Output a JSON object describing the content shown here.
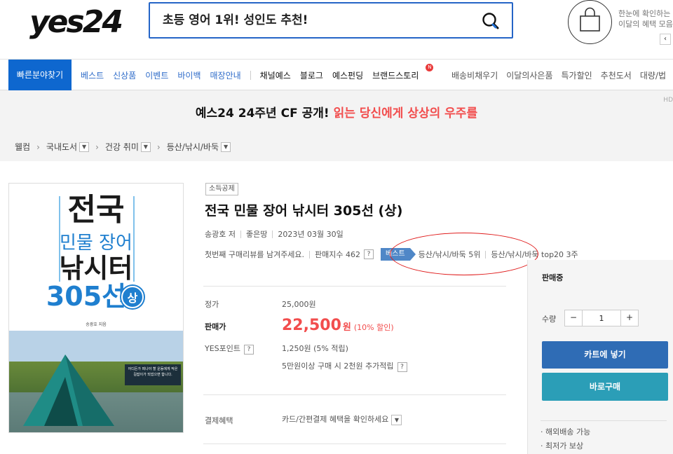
{
  "header": {
    "logo_text": "yes24",
    "search_placeholder": "초등 영어 1위! 성인도 추천!",
    "benefit_line1": "한눈에 확인하는",
    "benefit_line2": "이달의 혜택 모음",
    "scroll_right": "‹"
  },
  "gnb": {
    "quick": "빠른분야찾기",
    "blue_items": [
      "베스트",
      "신상품",
      "이벤트",
      "바이백",
      "매장안내"
    ],
    "dark_items": [
      "채널예스",
      "블로그",
      "예스펀딩",
      "브랜드스토리"
    ],
    "new_badge": "N",
    "right_items": [
      "배송비채우기",
      "이달의사은품",
      "특가할인",
      "추천도서",
      "대량/법"
    ]
  },
  "banner": {
    "text": "예스24 24주년 CF 공개!",
    "highlight": "읽는 당신에게 상상의 우주를",
    "corner": "HD"
  },
  "breadcrumb": [
    "웰컴",
    "국내도서",
    "건강 취미",
    "등산/낚시/바둑"
  ],
  "cover": {
    "line1": "전국",
    "line2": "민물 장어",
    "line3": "낚시터",
    "line4": "305선",
    "badge": "상",
    "author": "송광호 지음",
    "ribbon": "어디든가 떠나야 할 운동에게 작은 길잡이가 되었으면 합니다."
  },
  "product": {
    "tag": "소득공제",
    "title": "전국 민물 장어 낚시터 305선 (상)",
    "author": "송광호 저",
    "publisher": "좋은땅",
    "date": "2023년 03월 30일",
    "review_prompt": "첫번째 구매리뷰를 남겨주세요.",
    "sales_index": "판매지수 462",
    "help": "?",
    "best_label": "베스트",
    "best_rank": "등산/낚시/바둑 5위",
    "best_top": "등산/낚시/바둑 top20 3주"
  },
  "pricing": {
    "list_label": "정가",
    "list_price": "25,000원",
    "sale_label": "판매가",
    "sale_price": "22,500",
    "sale_unit": "원",
    "discount": "(10% 할인)",
    "point_label": "YES포인트",
    "point_value": "1,250원 (5% 적립)",
    "extra_point": "5만원이상 구매 시 2천원 추가적립",
    "payment_label": "결제혜택",
    "payment_value": "카드/간편결제 혜택을 확인하세요"
  },
  "sidebox": {
    "status": "판매중",
    "qty_label": "수량",
    "qty_value": "1",
    "minus": "−",
    "plus": "+",
    "cart": "카트에 넣기",
    "buy": "바로구매",
    "note1": "· 해외배송 가능",
    "note2": "· 최저가 보상"
  }
}
